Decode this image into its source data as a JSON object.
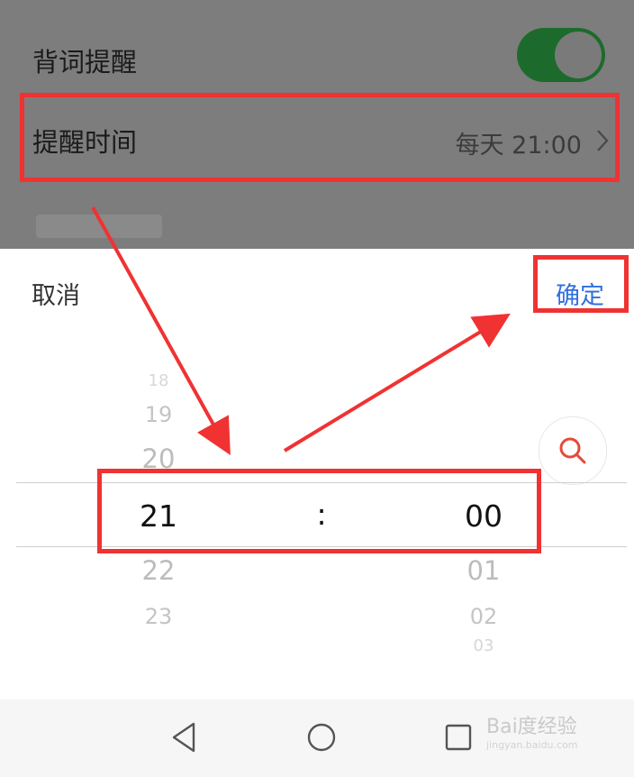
{
  "settings": {
    "reminder_label": "背词提醒",
    "reminder_toggle_on": true,
    "time_label": "提醒时间",
    "time_value": "每天 21:00"
  },
  "picker": {
    "cancel_label": "取消",
    "confirm_label": "确定",
    "separator": ":",
    "hours": {
      "above": [
        "18",
        "19",
        "20"
      ],
      "selected": "21",
      "below": [
        "22",
        "23"
      ]
    },
    "minutes": {
      "selected": "00",
      "below": [
        "01",
        "02",
        "03"
      ]
    }
  },
  "watermark": {
    "text": "Bai度经验",
    "url": "jingyan.baidu.com"
  },
  "colors": {
    "accent": "#2f6fe0",
    "toggle": "#1d6b2c",
    "annotation": "#f03232"
  },
  "icons": [
    "chevron-right-icon",
    "search-icon",
    "back-icon",
    "home-icon",
    "recents-icon"
  ]
}
